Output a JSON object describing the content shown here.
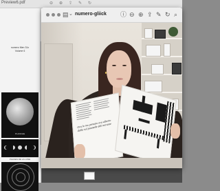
{
  "back_window": {
    "title": "Preview6.pdf",
    "cover_line1": "numero Men 31x",
    "cover_line2": "Volume 6",
    "plate_caption": "PLANCHE",
    "phases_caption": "PHASES DE LA LUNE"
  },
  "front_window": {
    "title": "numero-gliick",
    "toolbar_icons": [
      "sidebar-icon",
      "chevron-down-icon",
      "info-icon",
      "zoom-out-icon",
      "zoom-in-icon",
      "share-icon",
      "annotate-icon",
      "rotate-icon",
      "markup-icon",
      "search-icon"
    ]
  },
  "book": {
    "quote": "Ora lo mo pensato ora alberto dalla sul pannelle deli mirante"
  },
  "colors": {
    "window_bg": "#f6f6f6",
    "titlebar_bg": "#efefef",
    "desktop_bg": "#8b8b8b",
    "sweater": "#2d2521"
  }
}
